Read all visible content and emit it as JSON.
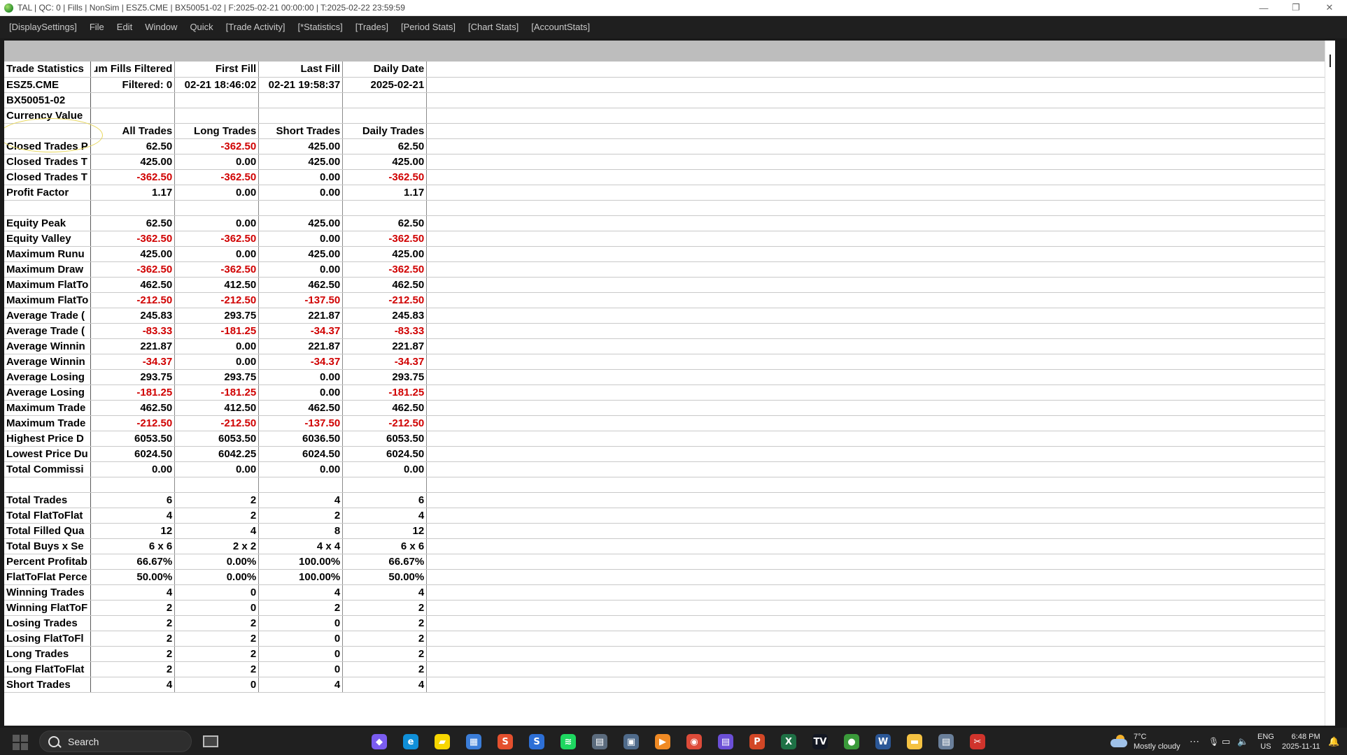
{
  "window": {
    "title": "TAL | QC: 0 | Fills | NonSim | ESZ5.CME | BX50051-02 | F:2025-02-21  00:00:00 | T:2025-02-22  23:59:59"
  },
  "menu": [
    "[DisplaySettings]",
    "File",
    "Edit",
    "Window",
    "Quick",
    "[Trade Activity]",
    "[*Statistics]",
    "[Trades]",
    "[Period Stats]",
    "[Chart Stats]",
    "[AccountStats]"
  ],
  "table": {
    "rows": [
      {
        "label": "Trade Statistics",
        "cells": [
          {
            "v": "ɹm Fills Filtered"
          },
          {
            "v": "First Fill"
          },
          {
            "v": "Last Fill"
          },
          {
            "v": "Daily Date"
          }
        ]
      },
      {
        "label": "ESZ5.CME",
        "cells": [
          {
            "v": "Filtered: 0"
          },
          {
            "v": "02-21  18:46:02"
          },
          {
            "v": "02-21  19:58:37"
          },
          {
            "v": "2025-02-21"
          }
        ]
      },
      {
        "label": "BX50051-02",
        "cells": [
          {
            "v": ""
          },
          {
            "v": ""
          },
          {
            "v": ""
          },
          {
            "v": ""
          }
        ]
      },
      {
        "label": "Currency Value",
        "cells": [
          {
            "v": ""
          },
          {
            "v": ""
          },
          {
            "v": ""
          },
          {
            "v": ""
          }
        ]
      },
      {
        "label": "",
        "cells": [
          {
            "v": "All Trades"
          },
          {
            "v": "Long Trades"
          },
          {
            "v": "Short Trades"
          },
          {
            "v": "Daily Trades"
          }
        ]
      },
      {
        "label": "Closed Trades P",
        "cells": [
          {
            "v": "62.50"
          },
          {
            "v": "-362.50",
            "neg": true
          },
          {
            "v": "425.00"
          },
          {
            "v": "62.50"
          }
        ]
      },
      {
        "label": "Closed Trades T",
        "cells": [
          {
            "v": "425.00"
          },
          {
            "v": "0.00"
          },
          {
            "v": "425.00"
          },
          {
            "v": "425.00"
          }
        ]
      },
      {
        "label": "Closed Trades T",
        "cells": [
          {
            "v": "-362.50",
            "neg": true
          },
          {
            "v": "-362.50",
            "neg": true
          },
          {
            "v": "0.00"
          },
          {
            "v": "-362.50",
            "neg": true
          }
        ]
      },
      {
        "label": "Profit Factor",
        "cells": [
          {
            "v": "1.17"
          },
          {
            "v": "0.00"
          },
          {
            "v": "0.00"
          },
          {
            "v": "1.17"
          }
        ]
      },
      {
        "label": "",
        "cells": [
          {
            "v": ""
          },
          {
            "v": ""
          },
          {
            "v": ""
          },
          {
            "v": ""
          }
        ]
      },
      {
        "label": "Equity Peak",
        "cells": [
          {
            "v": "62.50"
          },
          {
            "v": "0.00"
          },
          {
            "v": "425.00"
          },
          {
            "v": "62.50"
          }
        ]
      },
      {
        "label": "Equity Valley",
        "cells": [
          {
            "v": "-362.50",
            "neg": true
          },
          {
            "v": "-362.50",
            "neg": true
          },
          {
            "v": "0.00"
          },
          {
            "v": "-362.50",
            "neg": true
          }
        ]
      },
      {
        "label": "Maximum Runu",
        "cells": [
          {
            "v": "425.00"
          },
          {
            "v": "0.00"
          },
          {
            "v": "425.00"
          },
          {
            "v": "425.00"
          }
        ]
      },
      {
        "label": "Maximum Draw",
        "cells": [
          {
            "v": "-362.50",
            "neg": true
          },
          {
            "v": "-362.50",
            "neg": true
          },
          {
            "v": "0.00"
          },
          {
            "v": "-362.50",
            "neg": true
          }
        ]
      },
      {
        "label": "Maximum FlatTo",
        "cells": [
          {
            "v": "462.50"
          },
          {
            "v": "412.50"
          },
          {
            "v": "462.50"
          },
          {
            "v": "462.50"
          }
        ]
      },
      {
        "label": "Maximum FlatTo",
        "cells": [
          {
            "v": "-212.50",
            "neg": true
          },
          {
            "v": "-212.50",
            "neg": true
          },
          {
            "v": "-137.50",
            "neg": true
          },
          {
            "v": "-212.50",
            "neg": true
          }
        ]
      },
      {
        "label": "Average Trade (",
        "cells": [
          {
            "v": "245.83"
          },
          {
            "v": "293.75"
          },
          {
            "v": "221.87"
          },
          {
            "v": "245.83"
          }
        ]
      },
      {
        "label": "Average Trade (",
        "cells": [
          {
            "v": "-83.33",
            "neg": true
          },
          {
            "v": "-181.25",
            "neg": true
          },
          {
            "v": "-34.37",
            "neg": true
          },
          {
            "v": "-83.33",
            "neg": true
          }
        ]
      },
      {
        "label": "Average Winnin",
        "cells": [
          {
            "v": "221.87"
          },
          {
            "v": "0.00"
          },
          {
            "v": "221.87"
          },
          {
            "v": "221.87"
          }
        ]
      },
      {
        "label": "Average Winnin",
        "cells": [
          {
            "v": "-34.37",
            "neg": true
          },
          {
            "v": "0.00"
          },
          {
            "v": "-34.37",
            "neg": true
          },
          {
            "v": "-34.37",
            "neg": true
          }
        ]
      },
      {
        "label": "Average Losing",
        "cells": [
          {
            "v": "293.75"
          },
          {
            "v": "293.75"
          },
          {
            "v": "0.00"
          },
          {
            "v": "293.75"
          }
        ]
      },
      {
        "label": "Average Losing",
        "cells": [
          {
            "v": "-181.25",
            "neg": true
          },
          {
            "v": "-181.25",
            "neg": true
          },
          {
            "v": "0.00"
          },
          {
            "v": "-181.25",
            "neg": true
          }
        ]
      },
      {
        "label": "Maximum Trade",
        "cells": [
          {
            "v": "462.50"
          },
          {
            "v": "412.50"
          },
          {
            "v": "462.50"
          },
          {
            "v": "462.50"
          }
        ]
      },
      {
        "label": "Maximum Trade",
        "cells": [
          {
            "v": "-212.50",
            "neg": true
          },
          {
            "v": "-212.50",
            "neg": true
          },
          {
            "v": "-137.50",
            "neg": true
          },
          {
            "v": "-212.50",
            "neg": true
          }
        ]
      },
      {
        "label": "Highest Price D",
        "cells": [
          {
            "v": "6053.50"
          },
          {
            "v": "6053.50"
          },
          {
            "v": "6036.50"
          },
          {
            "v": "6053.50"
          }
        ]
      },
      {
        "label": "Lowest Price Du",
        "cells": [
          {
            "v": "6024.50"
          },
          {
            "v": "6042.25"
          },
          {
            "v": "6024.50"
          },
          {
            "v": "6024.50"
          }
        ]
      },
      {
        "label": "Total Commissi",
        "cells": [
          {
            "v": "0.00"
          },
          {
            "v": "0.00"
          },
          {
            "v": "0.00"
          },
          {
            "v": "0.00"
          }
        ]
      },
      {
        "label": "",
        "cells": [
          {
            "v": ""
          },
          {
            "v": ""
          },
          {
            "v": ""
          },
          {
            "v": ""
          }
        ]
      },
      {
        "label": "Total Trades",
        "cells": [
          {
            "v": "6"
          },
          {
            "v": "2"
          },
          {
            "v": "4"
          },
          {
            "v": "6"
          }
        ]
      },
      {
        "label": "Total FlatToFlat",
        "cells": [
          {
            "v": "4"
          },
          {
            "v": "2"
          },
          {
            "v": "2"
          },
          {
            "v": "4"
          }
        ]
      },
      {
        "label": "Total Filled Qua",
        "cells": [
          {
            "v": "12"
          },
          {
            "v": "4"
          },
          {
            "v": "8"
          },
          {
            "v": "12"
          }
        ]
      },
      {
        "label": "Total Buys x Se",
        "cells": [
          {
            "v": "6 x 6"
          },
          {
            "v": "2 x 2"
          },
          {
            "v": "4 x 4"
          },
          {
            "v": "6 x 6"
          }
        ]
      },
      {
        "label": "Percent Profitab",
        "cells": [
          {
            "v": "66.67%"
          },
          {
            "v": "0.00%"
          },
          {
            "v": "100.00%"
          },
          {
            "v": "66.67%"
          }
        ]
      },
      {
        "label": "FlatToFlat Perce",
        "cells": [
          {
            "v": "50.00%"
          },
          {
            "v": "0.00%"
          },
          {
            "v": "100.00%"
          },
          {
            "v": "50.00%"
          }
        ]
      },
      {
        "label": "Winning Trades",
        "cells": [
          {
            "v": "4"
          },
          {
            "v": "0"
          },
          {
            "v": "4"
          },
          {
            "v": "4"
          }
        ]
      },
      {
        "label": "Winning FlatToF",
        "cells": [
          {
            "v": "2"
          },
          {
            "v": "0"
          },
          {
            "v": "2"
          },
          {
            "v": "2"
          }
        ]
      },
      {
        "label": "Losing Trades",
        "cells": [
          {
            "v": "2"
          },
          {
            "v": "2"
          },
          {
            "v": "0"
          },
          {
            "v": "2"
          }
        ]
      },
      {
        "label": "Losing FlatToFl",
        "cells": [
          {
            "v": "2"
          },
          {
            "v": "2"
          },
          {
            "v": "0"
          },
          {
            "v": "2"
          }
        ]
      },
      {
        "label": "Long Trades",
        "cells": [
          {
            "v": "2"
          },
          {
            "v": "2"
          },
          {
            "v": "0"
          },
          {
            "v": "2"
          }
        ]
      },
      {
        "label": "Long FlatToFlat",
        "cells": [
          {
            "v": "2"
          },
          {
            "v": "2"
          },
          {
            "v": "0"
          },
          {
            "v": "2"
          }
        ]
      },
      {
        "label": "Short Trades",
        "cells": [
          {
            "v": "4"
          },
          {
            "v": "0"
          },
          {
            "v": "4"
          },
          {
            "v": "4"
          }
        ]
      }
    ]
  },
  "taskbar": {
    "search_label": "Search",
    "apps": [
      {
        "name": "copilot-icon",
        "color": "#7a5cf0",
        "glyph": "◆"
      },
      {
        "name": "edge-icon",
        "color": "#0f8fd8",
        "glyph": "e"
      },
      {
        "name": "sticky-notes-icon",
        "color": "#f7d600",
        "glyph": "▰"
      },
      {
        "name": "store-icon",
        "color": "#3b7dd8",
        "glyph": "▦"
      },
      {
        "name": "app-s-red-icon",
        "color": "#e4502e",
        "glyph": "S"
      },
      {
        "name": "app-s-blue-icon",
        "color": "#2d6fd6",
        "glyph": "S"
      },
      {
        "name": "spotify-icon",
        "color": "#1ed760",
        "glyph": "≋"
      },
      {
        "name": "calculator-icon",
        "color": "#5b6b7d",
        "glyph": "▤"
      },
      {
        "name": "window-app-icon",
        "color": "#4f6a8a",
        "glyph": "▣"
      },
      {
        "name": "media-player-icon",
        "color": "#f08a24",
        "glyph": "▶"
      },
      {
        "name": "chrome-icon",
        "color": "#dd4b39",
        "glyph": "◉"
      },
      {
        "name": "video-editor-icon",
        "color": "#6b4fd6",
        "glyph": "▤"
      },
      {
        "name": "powerpoint-icon",
        "color": "#d24726",
        "glyph": "P"
      },
      {
        "name": "excel-icon",
        "color": "#1e7145",
        "glyph": "X"
      },
      {
        "name": "tradingview-icon",
        "color": "#131722",
        "glyph": "TV"
      },
      {
        "name": "tal-app-icon",
        "color": "#3a9a3a",
        "glyph": "●"
      },
      {
        "name": "word-icon",
        "color": "#2b5797",
        "glyph": "W"
      },
      {
        "name": "file-explorer-icon",
        "color": "#f5c242",
        "glyph": "▬"
      },
      {
        "name": "notepad-icon",
        "color": "#6a7f9a",
        "glyph": "▤"
      },
      {
        "name": "snipping-tool-icon",
        "color": "#d0342c",
        "glyph": "✂"
      }
    ],
    "weather_temp": "7°C",
    "weather_desc": "Mostly cloudy",
    "lang_top": "ENG",
    "lang_bottom": "US",
    "time": "6:48 PM",
    "date": "2025-11-11"
  }
}
